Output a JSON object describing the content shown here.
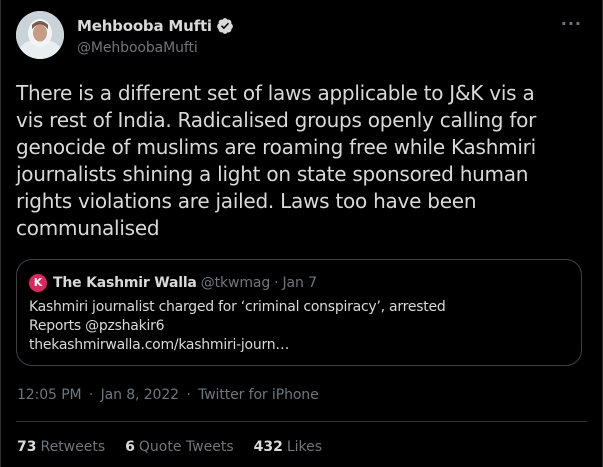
{
  "author": {
    "display_name": "Mehbooba Mufti",
    "handle": "@MehboobaMufti",
    "verified": true,
    "avatar_icon": "profile-photo"
  },
  "more_menu": "···",
  "tweet": {
    "lines": [
      "There is a different set of laws applicable to J&K vis a",
      "vis rest of India. Radicalised groups openly calling for",
      "genocide of muslims are roaming free while Kashmiri",
      "journalists shining a light on state sponsored human",
      "rights violations are jailed. Laws too have been",
      "communalised"
    ]
  },
  "quoted_tweet": {
    "avatar_letter": "K",
    "name": "The Kashmir Walla",
    "handle": "@tkwmag",
    "separator": "·",
    "date": "Jan 7",
    "lines": [
      "Kashmiri journalist charged for ‘criminal conspiracy’, arrested",
      "Reports @pzshakir6",
      "thekashmirwalla.com/kashmiri-journ…"
    ]
  },
  "meta": {
    "time": "12:05 PM",
    "sep1": "·",
    "date": "Jan 8, 2022",
    "sep2": "·",
    "source": "Twitter for iPhone"
  },
  "stats": {
    "retweets": {
      "count": "73",
      "label": "Retweets"
    },
    "quote_tweets": {
      "count": "6",
      "label": "Quote Tweets"
    },
    "likes": {
      "count": "432",
      "label": "Likes"
    }
  },
  "colors": {
    "background": "#000000",
    "text": "#d9d9d9",
    "secondary": "#6e767d",
    "verified": "#1da1f2",
    "border": "#2f3336"
  }
}
